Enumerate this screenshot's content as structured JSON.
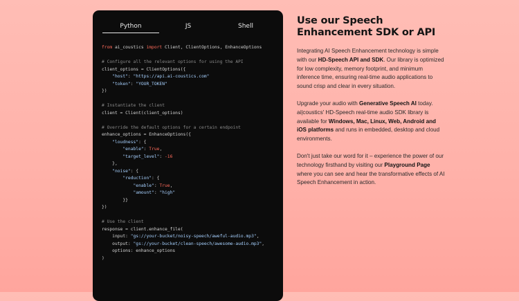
{
  "code_panel": {
    "tabs": [
      {
        "label": "Python",
        "active": true
      },
      {
        "label": "JS",
        "active": false
      },
      {
        "label": "Shell",
        "active": false
      }
    ],
    "lines": [
      [
        [
          "kw",
          "from"
        ],
        [
          "t",
          " ai_coustics "
        ],
        [
          "kw",
          "import"
        ],
        [
          "t",
          " Client, ClientOptions, EnhanceOptions"
        ]
      ],
      [],
      [
        [
          "cm",
          "# Configure all the relevant options for using the API"
        ]
      ],
      [
        [
          "t",
          "client_options = ClientOptions({"
        ]
      ],
      [
        [
          "t",
          "    "
        ],
        [
          "str",
          "\"host\""
        ],
        [
          "t",
          ": "
        ],
        [
          "str",
          "\"https://api.ai-coustics.com\""
        ]
      ],
      [
        [
          "t",
          "    "
        ],
        [
          "str",
          "\"token\""
        ],
        [
          "t",
          ": "
        ],
        [
          "str",
          "\"YOUR_TOKEN\""
        ]
      ],
      [
        [
          "t",
          "})"
        ]
      ],
      [],
      [
        [
          "cm",
          "# Instantiate the client"
        ]
      ],
      [
        [
          "t",
          "client = Client(client_options)"
        ]
      ],
      [],
      [
        [
          "cm",
          "# Override the default options for a certain endpoint"
        ]
      ],
      [
        [
          "t",
          "enhance_options = EnhanceOptions({"
        ]
      ],
      [
        [
          "t",
          "    "
        ],
        [
          "str",
          "\"loudness\""
        ],
        [
          "t",
          ": {"
        ]
      ],
      [
        [
          "t",
          "        "
        ],
        [
          "str",
          "\"enable\""
        ],
        [
          "t",
          ": "
        ],
        [
          "kw",
          "True"
        ],
        [
          "t",
          ","
        ]
      ],
      [
        [
          "t",
          "        "
        ],
        [
          "str",
          "\"target_level\""
        ],
        [
          "t",
          ": "
        ],
        [
          "num",
          "-16"
        ]
      ],
      [
        [
          "t",
          "    },"
        ]
      ],
      [
        [
          "t",
          "    "
        ],
        [
          "str",
          "\"noise\""
        ],
        [
          "t",
          ": {"
        ]
      ],
      [
        [
          "t",
          "        "
        ],
        [
          "str",
          "\"reduction\""
        ],
        [
          "t",
          ": {"
        ]
      ],
      [
        [
          "t",
          "            "
        ],
        [
          "str",
          "\"enable\""
        ],
        [
          "t",
          ": "
        ],
        [
          "kw",
          "True"
        ],
        [
          "t",
          ","
        ]
      ],
      [
        [
          "t",
          "            "
        ],
        [
          "str",
          "\"amount\""
        ],
        [
          "t",
          ": "
        ],
        [
          "str",
          "\"high\""
        ]
      ],
      [
        [
          "t",
          "        }}"
        ]
      ],
      [
        [
          "t",
          "})"
        ]
      ],
      [],
      [
        [
          "cm",
          "# Use the client"
        ]
      ],
      [
        [
          "t",
          "response = client.enhance_file("
        ]
      ],
      [
        [
          "t",
          "    input: "
        ],
        [
          "str",
          "\"gs://your-bucket/noisy-speech/aweful-audio.mp3\""
        ],
        [
          "t",
          ","
        ]
      ],
      [
        [
          "t",
          "    output: "
        ],
        [
          "str",
          "\"gs://your-bucket/clean-speech/awesome-audio.mp3\""
        ],
        [
          "t",
          ","
        ]
      ],
      [
        [
          "t",
          "    options: enhance_options"
        ]
      ],
      [
        [
          "t",
          ")"
        ]
      ]
    ]
  },
  "article": {
    "title_line1": "Use our Speech",
    "title_line2": "Enhancement SDK or API",
    "p1": {
      "a": "Integrating AI Speech Enhancement technology is simple with our ",
      "b1": "HD-Speech API and SDK",
      "c": ". Our library is optimized for low complexity, memory footprint, and minimum inference time, ensuring real-time audio applications to sound crisp and clear in every situation."
    },
    "p2": {
      "a": "Upgrade your audio with ",
      "b1": "Generative Speech AI",
      "c": " today. ai|coustics' HD-Speech real-time audio SDK library is available for ",
      "b2": "Windows, Mac, Linux, Web, Android and iOS platforms",
      "d": " and runs in embedded, desktop and cloud environments."
    },
    "p3": {
      "a": "Don't just take our word for it – experience the power of our technology firsthand by visiting our ",
      "b1": "Playground Page",
      "c": " where you can see and hear the transformative effects of AI Speech Enhancement in action."
    }
  },
  "colors": {
    "background": "#ffb3ab",
    "code_bg": "#0c0c0c",
    "keyword": "#ff6b5b",
    "string": "#a7d1ff",
    "comment": "#8a8a8a"
  }
}
